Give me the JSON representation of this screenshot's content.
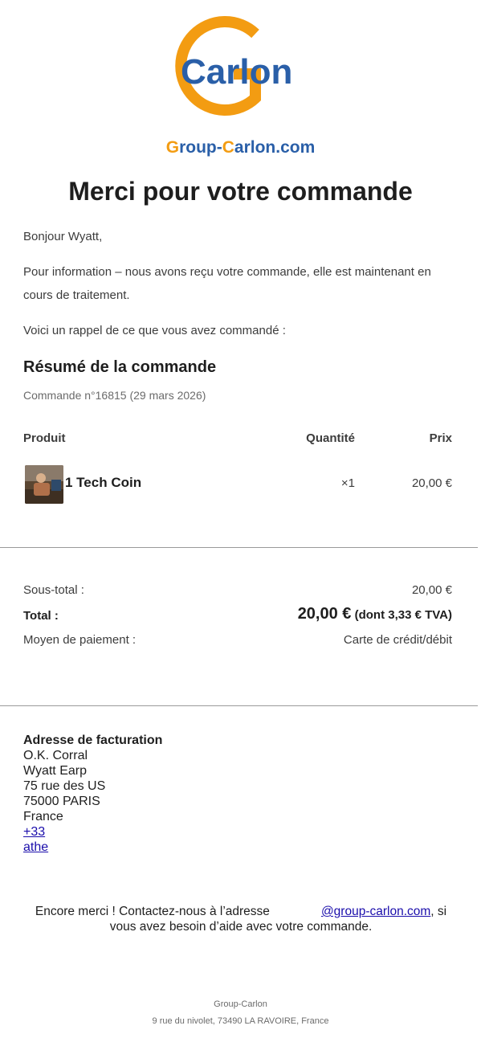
{
  "brand": {
    "logo_text": "Carlon",
    "url_parts": [
      "G",
      "roup-",
      "C",
      "arlon.com"
    ]
  },
  "title": "Merci pour votre commande",
  "greeting": "Bonjour Wyatt,",
  "info": "Pour information – nous avons reçu votre commande, elle est maintenant en cours de traitement.",
  "reminder": "Voici un rappel de ce que vous avez commandé :",
  "summary": {
    "heading": "Résumé de la commande",
    "order_meta": "Commande n°16815 (29 mars 2026)"
  },
  "table": {
    "headers": {
      "product": "Produit",
      "quantity": "Quantité",
      "price": "Prix"
    },
    "items": [
      {
        "name": "1 Tech Coin",
        "qty": "×1",
        "price": "20,00 €"
      }
    ]
  },
  "totals": {
    "subtotal_label": "Sous-total :",
    "subtotal_value": "20,00 €",
    "total_label": "Total :",
    "total_value": "20,00 €",
    "total_tax": "(dont 3,33 € TVA)",
    "payment_label": "Moyen de paiement :",
    "payment_value": "Carte de crédit/débit"
  },
  "billing": {
    "heading": "Adresse de facturation",
    "company": "O.K. Corral",
    "name": "Wyatt Earp",
    "street": "75 rue des US",
    "city": "75000 PARIS",
    "country": "France",
    "phone": "+33",
    "email": "athe"
  },
  "footer": {
    "pre": "Encore merci ! Contactez-nous à l’adresse",
    "email": "@group-carlon.com",
    "post": ", si vous avez besoin d’aide avec votre commande.",
    "company": "Group-Carlon",
    "address": "9 rue du nivolet, 73490 LA RAVOIRE, France"
  },
  "colors": {
    "brand_orange": "#f39c12",
    "brand_blue": "#2a5fa8",
    "link": "#1a0dab"
  }
}
